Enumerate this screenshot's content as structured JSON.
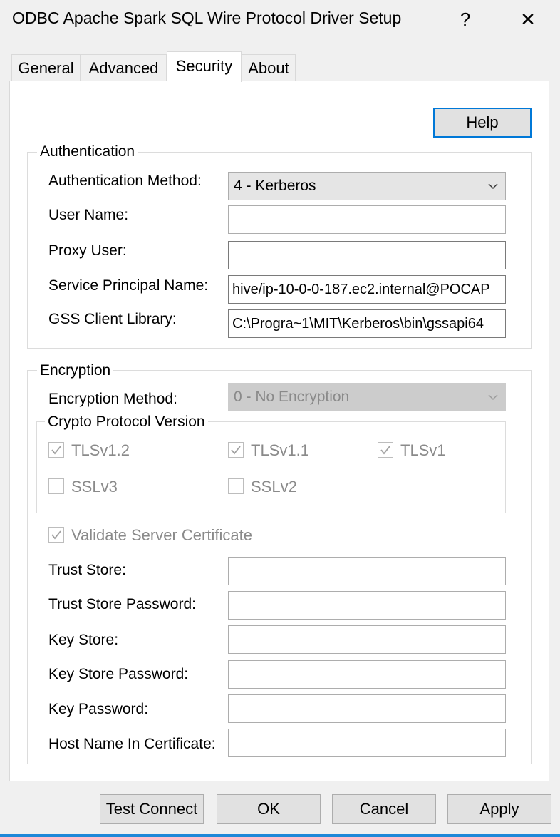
{
  "window": {
    "title": "ODBC Apache Spark SQL Wire Protocol Driver Setup",
    "help_glyph": "?",
    "close_glyph": "✕"
  },
  "tabs": [
    "General",
    "Advanced",
    "Security",
    "About"
  ],
  "help_button": "Help",
  "authentication": {
    "legend": "Authentication",
    "method_label": "Authentication Method:",
    "method_value": "4 - Kerberos",
    "user_name_label": "User Name:",
    "user_name_value": "",
    "proxy_user_label": "Proxy User:",
    "proxy_user_value": "",
    "spn_label": "Service Principal Name:",
    "spn_value": "hive/ip-10-0-0-187.ec2.internal@POCAP",
    "gss_label": "GSS Client Library:",
    "gss_value": "C:\\Progra~1\\MIT\\Kerberos\\bin\\gssapi64"
  },
  "encryption": {
    "legend": "Encryption",
    "method_label": "Encryption Method:",
    "method_value": "0 - No Encryption",
    "crypto_legend": "Crypto Protocol Version",
    "protocols": [
      {
        "label": "TLSv1.2",
        "checked": true
      },
      {
        "label": "TLSv1.1",
        "checked": true
      },
      {
        "label": "TLSv1",
        "checked": true
      },
      {
        "label": "SSLv3",
        "checked": false
      },
      {
        "label": "SSLv2",
        "checked": false
      }
    ],
    "validate_label": "Validate Server Certificate",
    "validate_checked": true,
    "trust_store_label": "Trust Store:",
    "trust_store_password_label": "Trust Store Password:",
    "key_store_label": "Key Store:",
    "key_store_password_label": "Key Store Password:",
    "key_password_label": "Key Password:",
    "host_name_label": "Host Name In Certificate:"
  },
  "footer": {
    "test_connect": "Test Connect",
    "ok": "OK",
    "cancel": "Cancel",
    "apply": "Apply"
  }
}
